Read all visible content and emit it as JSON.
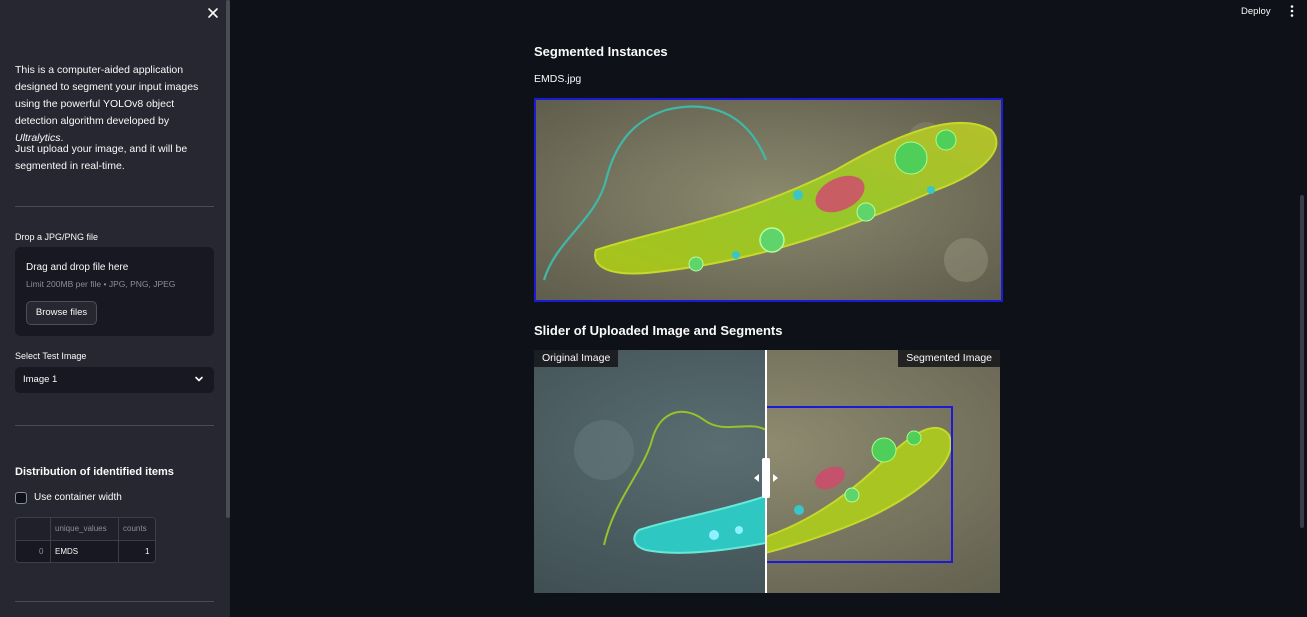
{
  "sidebar": {
    "intro_part1": "This is a computer-aided application designed to segment your input images using the powerful YOLOv8 object detection algorithm developed by ",
    "intro_brand": "Ultralytics",
    "intro_part2": ".",
    "instructions": "Just upload your image, and it will be segmented in real-time.",
    "uploader": {
      "label": "Drop a JPG/PNG file",
      "title": "Drag and drop file here",
      "limit": "Limit 200MB per file • JPG, PNG, JPEG",
      "button": "Browse files"
    },
    "select": {
      "label": "Select Test Image",
      "value": "Image 1"
    },
    "distribution": {
      "title": "Distribution of identified items",
      "checkbox_label": "Use container width",
      "checkbox_checked": false,
      "columns": [
        "unique_values",
        "counts"
      ],
      "rows": [
        {
          "index": "0",
          "unique_values": "EMDS",
          "counts": "1"
        }
      ]
    }
  },
  "header": {
    "deploy": "Deploy"
  },
  "main": {
    "segmented_heading": "Segmented Instances",
    "image_caption": "EMDS.jpg",
    "slider_heading": "Slider of Uploaded Image and Segments",
    "slider_left_label": "Original Image",
    "slider_right_label": "Segmented Image",
    "slider_position": 0.5
  },
  "colors": {
    "background": "#0e1117",
    "sidebar": "#262730",
    "bbox": "#1a1ad8"
  }
}
